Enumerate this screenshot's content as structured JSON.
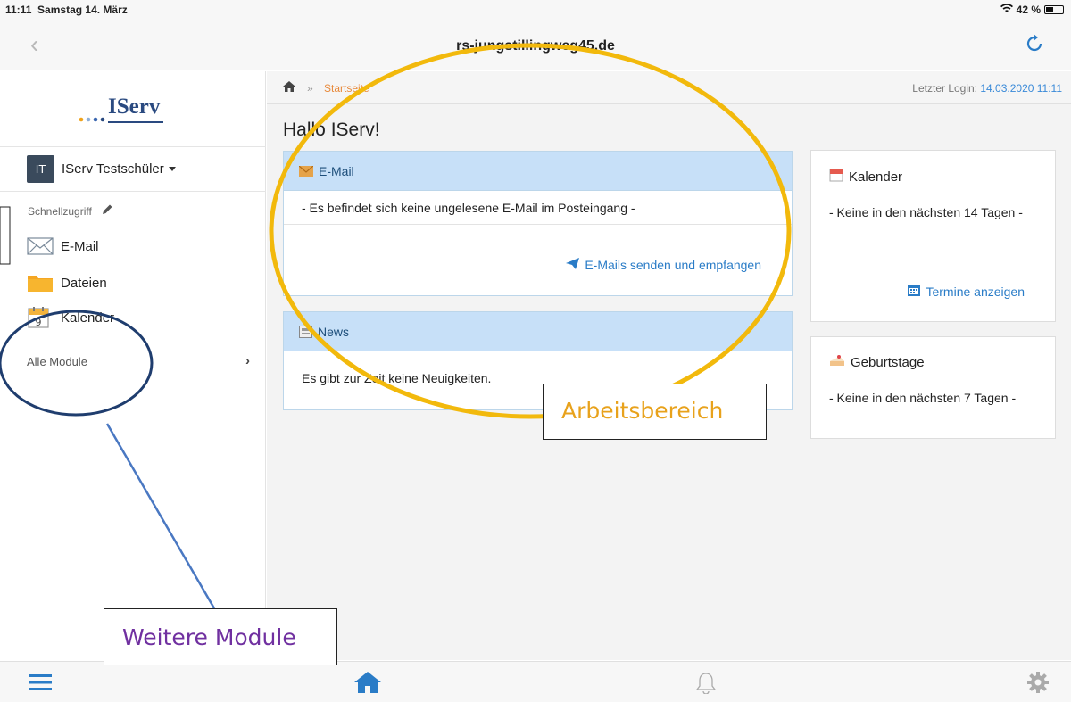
{
  "status": {
    "time": "11:11",
    "date": "Samstag 14. März",
    "battery": "42 %"
  },
  "browser": {
    "url": "rs-jungstillingweg45.de"
  },
  "sidebar": {
    "logo_text": "IServ",
    "user": {
      "initials": "IT",
      "name": "IServ Testschüler"
    },
    "quick_access_label": "Schnellzugriff",
    "items": [
      {
        "label": "E-Mail",
        "icon": "envelope-icon"
      },
      {
        "label": "Dateien",
        "icon": "folder-icon"
      },
      {
        "label": "Kalender",
        "icon": "calendar-icon"
      }
    ],
    "all_modules_label": "Alle Module"
  },
  "main": {
    "breadcrumb": {
      "separator": "»",
      "current": "Startseite",
      "last_login_label": "Letzter Login:",
      "last_login_value": "14.03.2020 11:11"
    },
    "greeting": "Hallo IServ!",
    "email_panel": {
      "title": "E-Mail",
      "message": "- Es befindet sich keine ungelesene E-Mail im Posteingang -",
      "link": "E-Mails senden und empfangen"
    },
    "news_panel": {
      "title": "News",
      "message": "Es gibt zur Zeit keine Neuigkeiten."
    },
    "calendar_card": {
      "title": "Kalender",
      "text": "- Keine in den nächsten 14 Tagen -",
      "link": "Termine anzeigen"
    },
    "birthday_card": {
      "title": "Geburtstage",
      "text": "- Keine in den nächsten 7 Tagen -"
    }
  },
  "annotations": {
    "work_area": "Arbeitsbereich",
    "more_modules": "Weitere Module",
    "colors": {
      "highlight_ellipse": "#f2b90c",
      "circle": "#1f3d6e",
      "pointer_line": "#4a78c2",
      "label_orange": "#e8a21c",
      "label_purple": "#7030a0"
    }
  },
  "colors": {
    "accent": "#2a7cc7",
    "breadcrumb_active": "#e8893a",
    "panel_header": "#c7e0f8"
  }
}
